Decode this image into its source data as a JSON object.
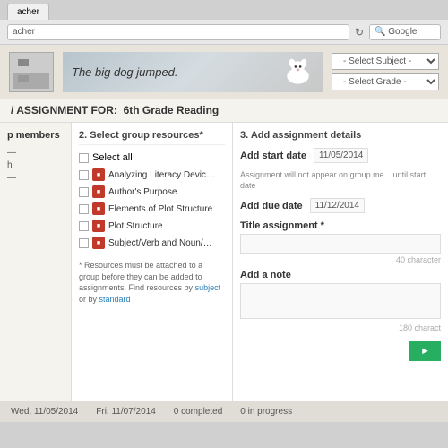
{
  "browser": {
    "tab_label": "acher",
    "url_placeholder": "acher",
    "refresh_icon": "↻",
    "search_placeholder": "Google",
    "search_icon": "🔍"
  },
  "header": {
    "logo_alt": "Logo",
    "tagline": "The big dog jumped.",
    "select_subject_label": "- Select Subject -",
    "select_grade_label": "- Select Grade -"
  },
  "assignment_bar": {
    "prefix": "/ ASSIGNMENT FOR:",
    "class_name": "6th Grade Reading"
  },
  "col1": {
    "title": "p members",
    "members": [
      "",
      "h",
      ""
    ]
  },
  "col2": {
    "title": "2. Select group resources*",
    "select_all_label": "Select all",
    "resources": [
      "Analyzing Literacy Devices in...",
      "Author's Purpose",
      "Elements of Plot Structure",
      "Plot Structure",
      "Subject/Verb and Noun/Pronoun..."
    ],
    "footer_text": "* Resources must be attached to a group before they can be added to assignments. Find resources by",
    "link1": "subject",
    "middle_text": "or by",
    "link2": "standard",
    "footer_end": "."
  },
  "col3": {
    "title": "3. Add assignment details",
    "start_date_label": "Add start date",
    "start_date_value": "11/05/2014",
    "start_date_note": "Assignment will not appear on group me... until start date",
    "due_date_label": "Add due date",
    "due_date_value": "11/12/2014",
    "title_label": "Title assignment *",
    "title_char_count": "40 character",
    "note_label": "Add a note",
    "note_char_count": "180 charact",
    "submit_label": "►"
  },
  "footer": {
    "date1": "Wed, 11/05/2014",
    "date2": "Fri, 11/07/2014",
    "completed_label": "0 completed",
    "in_progress_label": "0 in progress"
  }
}
